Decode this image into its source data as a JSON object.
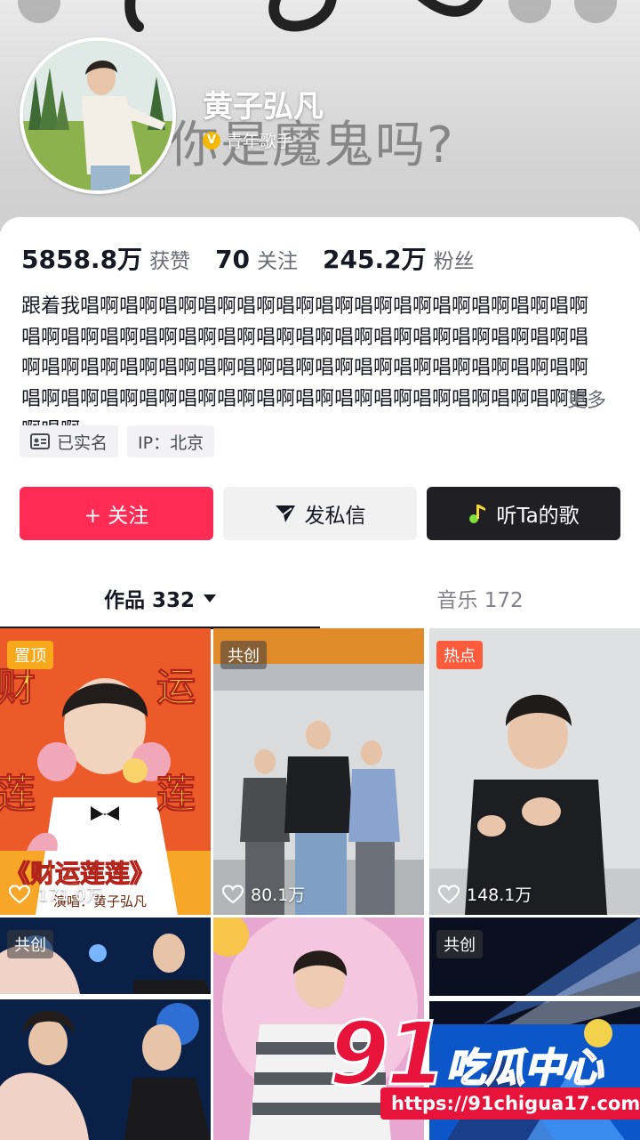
{
  "profile": {
    "name": "黄子弘凡",
    "verified_label": "青年歌手",
    "verified_mark": "V",
    "background_text": "你是魔鬼吗?"
  },
  "stats": [
    {
      "value": "5858.8万",
      "label": "获赞"
    },
    {
      "value": "70",
      "label": "关注"
    },
    {
      "value": "245.2万",
      "label": "粉丝"
    }
  ],
  "bio": {
    "text": "跟着我唱啊唱啊唱啊唱啊唱啊唱啊唱啊唱啊唱啊唱啊唱啊唱啊唱啊唱啊唱啊唱啊唱啊唱啊唱啊唱啊唱啊唱啊唱啊唱啊唱啊唱啊唱啊唱啊唱啊唱啊唱啊唱啊唱啊唱啊唱啊唱啊唱啊唱啊唱啊唱啊唱啊唱啊唱啊唱啊唱啊唱啊唱啊唱啊唱啊唱啊唱啊唱啊唱啊唱啊唱啊唱啊唱啊唱啊…",
    "more": "更多"
  },
  "tags": [
    {
      "label": "已实名",
      "icon": "id-card-icon"
    },
    {
      "label": "IP：北京"
    }
  ],
  "actions": {
    "follow": "+ 关注",
    "message": "发私信",
    "listen": "听Ta的歌"
  },
  "tabs": {
    "works": "作品 332",
    "music": "音乐 172"
  },
  "videos": [
    {
      "badge": "置顶",
      "likes": "171.0万",
      "overlay": "《财运莲莲》",
      "overlay2": "演唱：黄子弘凡",
      "chars": [
        "财",
        "运",
        "莲",
        "莲"
      ]
    },
    {
      "badge": "共创",
      "likes": "80.1万"
    },
    {
      "badge": "热点",
      "likes": "148.1万"
    },
    {
      "badge": "共创"
    },
    {},
    {
      "badge": "共创"
    }
  ],
  "watermark": {
    "big": "91",
    "cn": "吃瓜中心",
    "url": "https://91chigua17.com"
  },
  "colors": {
    "follow_button": "#fe2c55",
    "listen_button": "#1f1f24",
    "watermark": "#e8133b",
    "verified_badge": "#f5b800"
  }
}
